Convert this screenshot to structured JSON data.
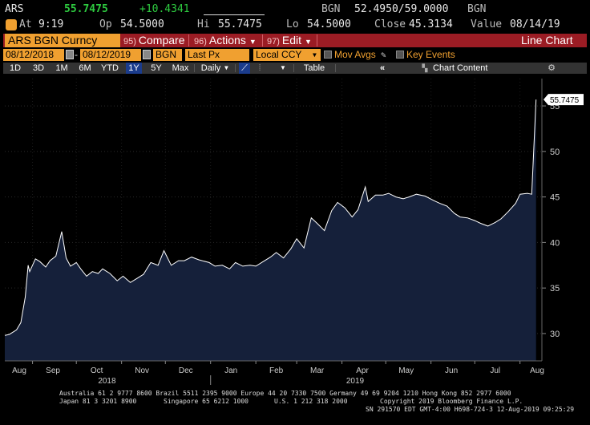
{
  "quote": {
    "ticker": "ARS",
    "last": "55.7475",
    "change": "+10.4341",
    "source": "BGN",
    "bid_ask": "52.4950/59.0000",
    "source2": "BGN",
    "at_label": "At",
    "at_time": "9:19",
    "open_label": "Op",
    "open": "54.5000",
    "high_label": "Hi",
    "high": "55.7475",
    "low_label": "Lo",
    "low": "54.5000",
    "close_label": "Close",
    "close": "45.3134",
    "value_label": "Value",
    "value_date": "08/14/19"
  },
  "toolbar": {
    "security": "ARS BGN Curncy",
    "compare_num": "95)",
    "compare_label": "Compare",
    "actions_num": "96)",
    "actions_label": "Actions",
    "edit_num": "97)",
    "edit_label": "Edit",
    "chart_type": "Line Chart"
  },
  "controls": {
    "start_date": "08/12/2018",
    "end_date": "08/12/2019",
    "source": "BGN",
    "field": "Last Px",
    "currency": "Local CCY",
    "mov_avgs": "Mov Avgs",
    "key_events": "Key Events"
  },
  "range": {
    "buttons": [
      "1D",
      "3D",
      "1M",
      "6M",
      "YTD",
      "1Y",
      "5Y",
      "Max"
    ],
    "active": "1Y",
    "frequency": "Daily",
    "table": "Table",
    "chart_content": "Chart Content"
  },
  "colors": {
    "amber": "#f0a030",
    "menu_red": "#9b1c24",
    "area_fill": "#15203a",
    "line": "#ffffff"
  },
  "chart_data": {
    "type": "area",
    "ylim": [
      27,
      58
    ],
    "yticks": [
      "30",
      "35",
      "40",
      "45",
      "50",
      "55"
    ],
    "xticks": [
      "Aug",
      "Sep",
      "Oct",
      "Nov",
      "Dec",
      "Jan",
      "Feb",
      "Mar",
      "Apr",
      "May",
      "Jun",
      "Jul",
      "Aug"
    ],
    "year_labels": [
      "2018",
      "2019"
    ],
    "last_value_label": "55.7475",
    "x": [
      "2018-08-13",
      "2018-08-16",
      "2018-08-21",
      "2018-08-24",
      "2018-08-27",
      "2018-08-29",
      "2018-08-30",
      "2018-09-03",
      "2018-09-06",
      "2018-09-10",
      "2018-09-13",
      "2018-09-17",
      "2018-09-21",
      "2018-09-24",
      "2018-09-27",
      "2018-10-01",
      "2018-10-04",
      "2018-10-08",
      "2018-10-12",
      "2018-10-16",
      "2018-10-19",
      "2018-10-24",
      "2018-10-29",
      "2018-11-02",
      "2018-11-07",
      "2018-11-12",
      "2018-11-16",
      "2018-11-21",
      "2018-11-26",
      "2018-11-30",
      "2018-12-05",
      "2018-12-10",
      "2018-12-14",
      "2018-12-19",
      "2018-12-24",
      "2018-12-31",
      "2019-01-04",
      "2019-01-09",
      "2019-01-14",
      "2019-01-18",
      "2019-01-23",
      "2019-01-28",
      "2019-02-01",
      "2019-02-06",
      "2019-02-11",
      "2019-02-15",
      "2019-02-20",
      "2019-02-25",
      "2019-03-01",
      "2019-03-06",
      "2019-03-11",
      "2019-03-15",
      "2019-03-20",
      "2019-03-25",
      "2019-03-29",
      "2019-04-03",
      "2019-04-08",
      "2019-04-12",
      "2019-04-17",
      "2019-04-19",
      "2019-04-24",
      "2019-04-29",
      "2019-05-03",
      "2019-05-08",
      "2019-05-13",
      "2019-05-17",
      "2019-05-22",
      "2019-05-28",
      "2019-06-03",
      "2019-06-07",
      "2019-06-12",
      "2019-06-17",
      "2019-06-21",
      "2019-06-26",
      "2019-07-01",
      "2019-07-05",
      "2019-07-10",
      "2019-07-15",
      "2019-07-19",
      "2019-07-24",
      "2019-07-29",
      "2019-08-01",
      "2019-08-06",
      "2019-08-09",
      "2019-08-12"
    ],
    "values": [
      29.8,
      29.9,
      30.4,
      31.2,
      34.0,
      37.5,
      36.8,
      38.2,
      37.9,
      37.3,
      38.0,
      38.5,
      41.2,
      38.3,
      37.4,
      37.8,
      37.1,
      36.3,
      36.8,
      36.6,
      37.1,
      36.6,
      35.8,
      36.3,
      35.6,
      36.1,
      36.5,
      37.8,
      37.5,
      39.1,
      37.5,
      38.0,
      38.0,
      38.4,
      38.1,
      37.8,
      37.4,
      37.5,
      37.1,
      37.8,
      37.4,
      37.5,
      37.4,
      37.9,
      38.4,
      38.9,
      38.3,
      39.3,
      40.4,
      39.4,
      42.7,
      42.1,
      41.3,
      43.5,
      44.4,
      43.8,
      42.8,
      43.6,
      46.1,
      44.5,
      45.2,
      45.2,
      45.4,
      45.0,
      44.8,
      45.0,
      45.3,
      45.1,
      44.6,
      44.3,
      44.0,
      43.2,
      42.8,
      42.7,
      42.4,
      42.1,
      41.8,
      42.2,
      42.6,
      43.4,
      44.3,
      45.3,
      45.4,
      45.3,
      55.7
    ]
  },
  "footer": {
    "line1": "Australia 61 2 9777 8600 Brazil 5511 2395 9000 Europe 44 20 7330 7500 Germany 49 69 9204 1210 Hong Kong 852 2977 6000",
    "line2a": "Japan 81 3 3201 8900",
    "line2b": "Singapore 65 6212 1000",
    "line2c": "U.S. 1 212 318 2000",
    "line2d": "Copyright 2019 Bloomberg Finance L.P.",
    "line3": "SN 291570 EDT  GMT-4:00 H698-724-3 12-Aug-2019 09:25:29"
  }
}
